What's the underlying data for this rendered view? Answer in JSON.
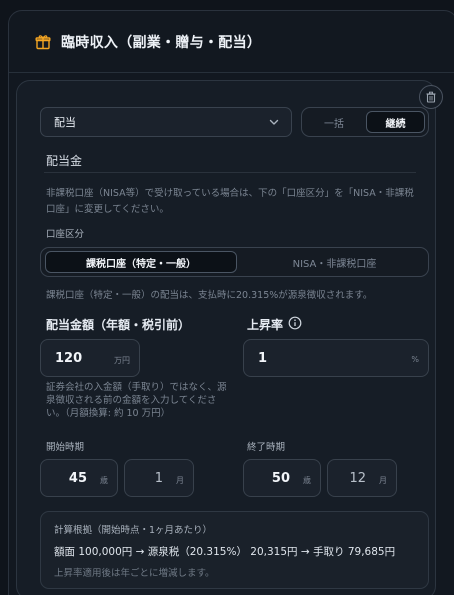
{
  "header": {
    "title": "臨時収入（副業・贈与・配当）",
    "icon": "gift-icon",
    "accent": "#f5a623"
  },
  "item": {
    "type_select": {
      "value": "配当"
    },
    "mode": {
      "options": [
        "一括",
        "継続"
      ],
      "selected": "継続"
    },
    "section_title": "配当金",
    "nisa_note": "非課税口座（NISA等）で受け取っている場合は、下の「口座区分」を「NISA・非課税口座」に変更してください。",
    "account": {
      "label": "口座区分",
      "options": [
        "課税口座（特定・一般）",
        "NISA・非課税口座"
      ],
      "selected": "課税口座（特定・一般）",
      "note": "課税口座（特定・一般）の配当は、支払時に20.315%が源泉徴収されます。"
    },
    "amount": {
      "label": "配当金額（年額・税引前）",
      "value": "120",
      "unit": "万円",
      "hint": "証券会社の入金額（手取り）ではなく、源泉徴収される前の金額を入力してください。（月額換算: 約 10 万円）"
    },
    "growth": {
      "label": "上昇率",
      "value": "1",
      "unit": "%"
    },
    "start": {
      "label": "開始時期",
      "age": "45",
      "age_unit": "歳",
      "month": "1",
      "month_unit": "月"
    },
    "end": {
      "label": "終了時期",
      "age": "50",
      "age_unit": "歳",
      "month": "12",
      "month_unit": "月"
    },
    "basis": {
      "title": "計算根拠（開始時点・1ヶ月あたり）",
      "calc": "額面 100,000円 → 源泉税（20.315%） 20,315円 → 手取り 79,685円",
      "note": "上昇率適用後は年ごとに増減します。"
    }
  }
}
